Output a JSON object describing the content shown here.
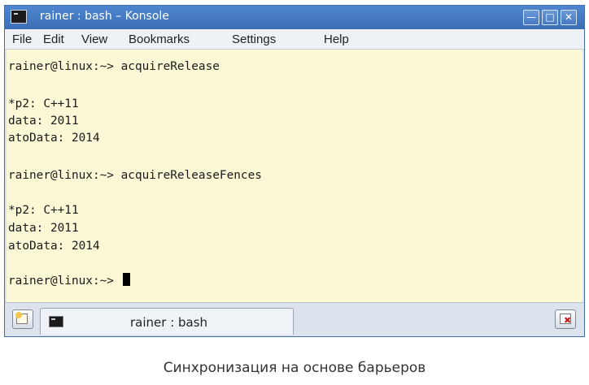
{
  "window": {
    "title": "rainer : bash – Konsole",
    "controls": {
      "minimize": "—",
      "maximize": "□",
      "close": "✕"
    }
  },
  "menu": [
    "File",
    "Edit",
    "View",
    "Bookmarks",
    "Settings",
    "Help"
  ],
  "terminal": {
    "lines": [
      "rainer@linux:~> acquireRelease",
      "",
      "*p2: C++11",
      "data: 2011",
      "atoData: 2014",
      "",
      "rainer@linux:~> acquireReleaseFences",
      "",
      "*p2: C++11",
      "data: 2011",
      "atoData: 2014",
      "",
      "rainer@linux:~> "
    ]
  },
  "tabs": [
    {
      "label": "rainer : bash"
    }
  ],
  "caption": "Синхронизация на основе барьеров"
}
